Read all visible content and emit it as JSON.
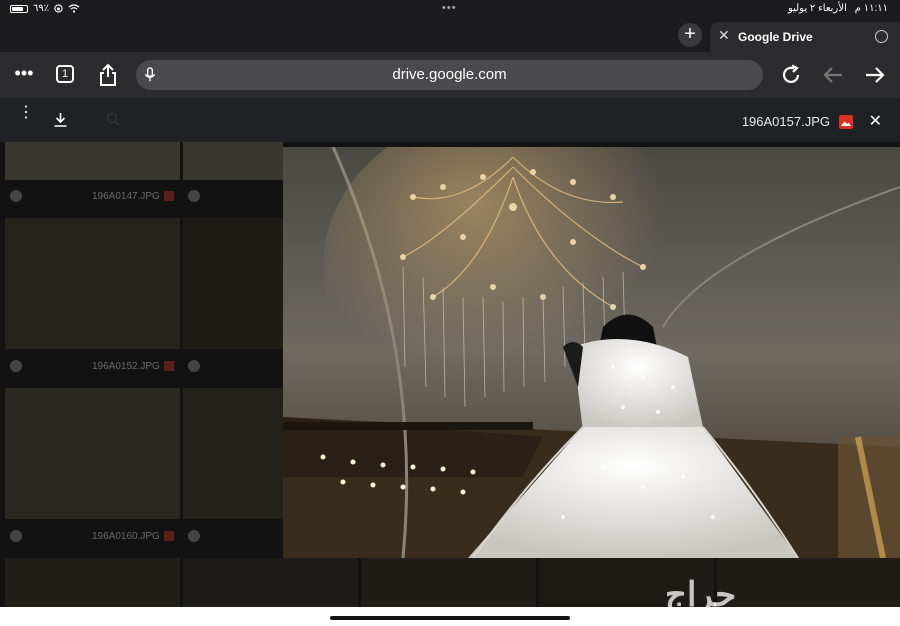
{
  "status_bar": {
    "battery_percent": "٦٩٪",
    "time": "١١:١١ م",
    "date": "الأربعاء ٢ يوليو",
    "multitask_dots": "•••"
  },
  "tabs": [
    {
      "title": "Google Drive"
    }
  ],
  "toolbar": {
    "tab_count": "1",
    "url": "drive.google.com"
  },
  "viewer": {
    "file_name": "196A0157.JPG"
  },
  "background_files": [
    {
      "name": "196A0147.JPG"
    },
    {
      "name": "196A0152.JPG"
    },
    {
      "name": "196A0160.JPG"
    }
  ],
  "watermark": "حراج",
  "colors": {
    "accent_red": "#d93025",
    "toolbar_bg": "#2c2c2e",
    "url_bg": "#4a4a4c"
  },
  "icons": [
    "wifi-icon",
    "battery-icon",
    "more-icon",
    "tabs-icon",
    "share-icon",
    "mic-icon",
    "reload-icon",
    "back-icon",
    "forward-icon",
    "new-tab-icon",
    "close-tab-icon",
    "download-icon",
    "close-icon",
    "image-file-icon"
  ]
}
